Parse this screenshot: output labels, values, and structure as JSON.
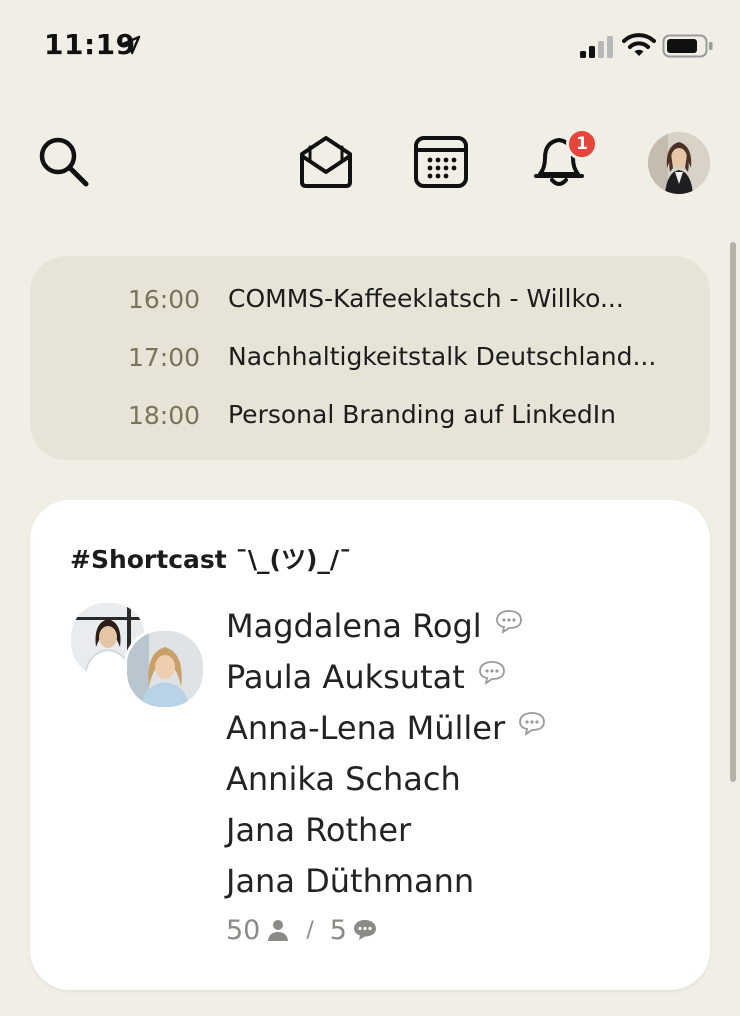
{
  "status_bar": {
    "time": "11:19",
    "icons": [
      "location-arrow-icon",
      "signal-icon",
      "wifi-icon",
      "battery-icon"
    ]
  },
  "toolbar": {
    "icons": [
      "search-icon",
      "envelope-icon",
      "calendar-icon",
      "bell-icon"
    ],
    "notification_count": "1"
  },
  "upcoming_events": [
    {
      "time": "16:00",
      "title": "COMMS-Kaffeeklatsch - Willko..."
    },
    {
      "time": "17:00",
      "title": "Nachhaltigkeitstalk Deutschland..."
    },
    {
      "time": "18:00",
      "title": "Personal Branding auf LinkedIn"
    }
  ],
  "room": {
    "title": "#Shortcast ¯\\_(ツ)_/¯",
    "speakers": [
      {
        "name": "Magdalena Rogl",
        "speaking": true
      },
      {
        "name": "Paula Auksutat",
        "speaking": true
      },
      {
        "name": "Anna-Lena Müller",
        "speaking": true
      },
      {
        "name": "Annika Schach",
        "speaking": false
      },
      {
        "name": "Jana Rother",
        "speaking": false
      },
      {
        "name": "Jana Düthmann",
        "speaking": false
      }
    ],
    "listener_count": "50",
    "speaker_count": "5",
    "stat_divider": "/"
  },
  "colors": {
    "background": "#f1eee6",
    "events_card": "#e7e3d6",
    "event_time": "#7c7358",
    "badge": "#e5453a"
  }
}
